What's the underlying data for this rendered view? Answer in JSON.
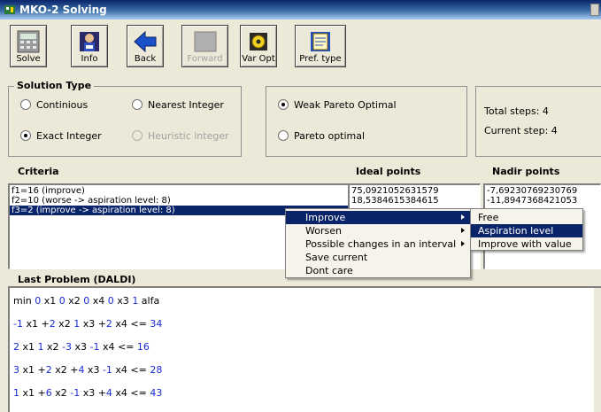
{
  "window": {
    "title": "MKO-2 Solving"
  },
  "toolbar": {
    "solve": "Solve",
    "info": "Info",
    "back": "Back",
    "forward": "Forward",
    "var_opt": "Var Opt",
    "pref_type": "Pref. type"
  },
  "solution_type": {
    "legend": "Solution Type",
    "continuous": "Continious",
    "nearest_integer": "Nearest Integer",
    "exact_integer": "Exact Integer",
    "heuristic_integer": "Heuristic integer",
    "weak_pareto": "Weak Pareto Optimal",
    "pareto": "Pareto optimal",
    "selected_integer_mode": "Exact Integer",
    "selected_pareto_mode": "Weak Pareto Optimal"
  },
  "status": {
    "total_steps": "Total steps: 4",
    "current_step": "Current step: 4"
  },
  "columns": {
    "criteria": "Criteria",
    "ideal": "Ideal points",
    "nadir": "Nadir points"
  },
  "criteria": [
    "f1=16 (improve)",
    "f2=10 (worse -> aspiration level: 8)",
    "f3=2 (improve -> aspiration level: 8)"
  ],
  "ideal_points": [
    "75,0921052631579",
    "18,5384615384615"
  ],
  "nadir_points": [
    "-7,69230769230769",
    "-11,8947368421053"
  ],
  "context_menu": {
    "items": [
      "Improve",
      "Worsen",
      "Possible changes in an interval",
      "Save current",
      "Dont care"
    ],
    "highlighted": "Improve"
  },
  "submenu": {
    "items": [
      "Free",
      "Aspiration level",
      "Improve with value"
    ],
    "highlighted": "Aspiration level"
  },
  "problem": {
    "title": "Last Problem (DALDI)",
    "objective": {
      "p1": "min ",
      "c1": "0",
      "p2": " x1 ",
      "c2": "0",
      "p3": " x2 ",
      "c3": "0",
      "p4": " x4 ",
      "c4": "0",
      "p5": " x3 ",
      "c5": "1",
      "p6": " alfa"
    },
    "constraints": [
      {
        "c1": "-1",
        "p1": " x1 +",
        "c2": "2",
        "p2": " x2 ",
        "c3": "1",
        "p3": " x3 +",
        "c4": "2",
        "p4": " x4 <= ",
        "rhs": "34"
      },
      {
        "c1": "2",
        "p1": " x1 ",
        "c2": "1",
        "p2": " x2 ",
        "c3": "-3",
        "p3": " x3 ",
        "c4": "-1",
        "p4": " x4 <= ",
        "rhs": "16"
      },
      {
        "c1": "3",
        "p1": " x1 +",
        "c2": "2",
        "p2": " x2 +",
        "c3": "4",
        "p3": " x3 ",
        "c4": "-1",
        "p4": " x4 <= ",
        "rhs": "28"
      },
      {
        "c1": "1",
        "p1": " x1 +",
        "c2": "6",
        "p2": " x2 ",
        "c3": "-1",
        "p3": " x3 +",
        "c4": "4",
        "p4": " x4 <= ",
        "rhs": "43"
      }
    ]
  },
  "colors": {
    "titlebar": "#0a246a",
    "selection": "#0a246a",
    "coefficient": "#1a2bd6",
    "face": "#ece9d8"
  }
}
